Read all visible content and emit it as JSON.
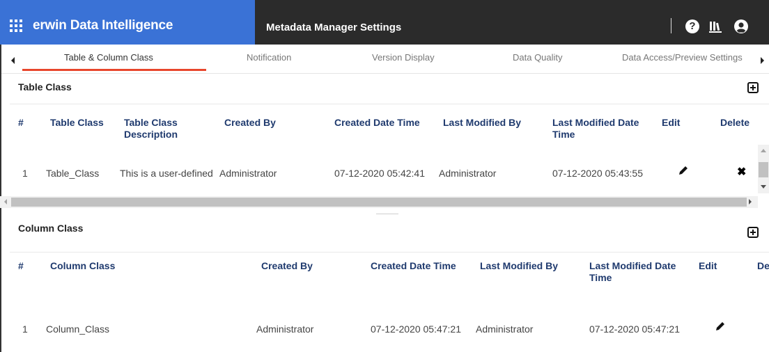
{
  "header": {
    "brand_title": "erwin Data Intelligence",
    "page_title": "Metadata Manager Settings",
    "brand_color": "#3a72d6",
    "bar_color": "#2b2b2b",
    "help_glyph": "?"
  },
  "tabs": [
    {
      "label": "Table & Column Class",
      "active": true
    },
    {
      "label": "Notification",
      "active": false
    },
    {
      "label": "Version Display",
      "active": false
    },
    {
      "label": "Data Quality",
      "active": false
    },
    {
      "label": "Data Access/Preview Settings",
      "active": false
    }
  ],
  "accent_color": "#e8462c",
  "table_class": {
    "title": "Table Class",
    "columns": [
      "#",
      "Table Class",
      "Table Class Description",
      "Created By",
      "Created Date Time",
      "Last Modified By",
      "Last Modified Date Time",
      "Edit",
      "Delete"
    ],
    "rows": [
      {
        "num": "1",
        "table_class": "Table_Class",
        "description": "This is a user-defined",
        "created_by": "Administrator",
        "created_date": "07-12-2020 05:42:41",
        "modified_by": "Administrator",
        "modified_date": "07-12-2020 05:43:55"
      }
    ]
  },
  "column_class": {
    "title": "Column Class",
    "columns": [
      "#",
      "Column Class",
      "Created By",
      "Created Date Time",
      "Last Modified By",
      "Last Modified Date Time",
      "Edit",
      "De"
    ],
    "rows": [
      {
        "num": "1",
        "column_class": "Column_Class",
        "created_by": "Administrator",
        "created_date": "07-12-2020 05:47:21",
        "modified_by": "Administrator",
        "modified_date": "07-12-2020 05:47:21"
      }
    ]
  }
}
